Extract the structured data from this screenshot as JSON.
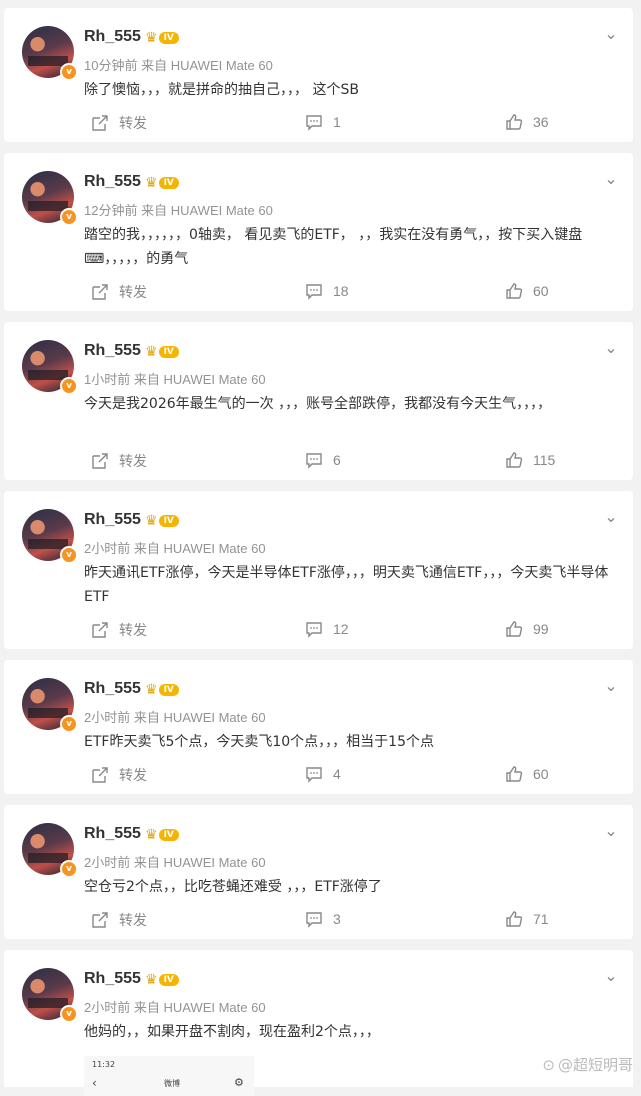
{
  "feed": {
    "comments": [
      {
        "user": "Rh_555",
        "level": "IV",
        "verified": "v",
        "time": "10分钟前",
        "source": "来自 HUAWEI Mate 60",
        "text": "除了懊恼，，，就是拼命的抽自己，，，  这个SB",
        "share": "转发",
        "comments": "1",
        "likes": "36"
      },
      {
        "user": "Rh_555",
        "level": "IV",
        "verified": "v",
        "time": "12分钟前",
        "source": "来自 HUAWEI Mate 60",
        "text": "踏空的我，，，，，，0轴卖，  看见卖飞的ETF，     ，，我实在没有勇气，，按下买入键盘⌨，，，，，的勇气",
        "share": "转发",
        "comments": "18",
        "likes": "60"
      },
      {
        "user": "Rh_555",
        "level": "IV",
        "verified": "v",
        "time": "1小时前",
        "source": "来自 HUAWEI Mate 60",
        "text": "今天是我2026年最生气的一次  ，，，账号全部跌停，我都没有今天生气，，，，",
        "share": "转发",
        "comments": "6",
        "likes": "115"
      },
      {
        "user": "Rh_555",
        "level": "IV",
        "verified": "v",
        "time": "2小时前",
        "source": "来自 HUAWEI Mate 60",
        "text": "昨天通讯ETF涨停，今天是半导体ETF涨停，，，明天卖飞通信ETF，，，今天卖飞半导体ETF",
        "share": "转发",
        "comments": "12",
        "likes": "99"
      },
      {
        "user": "Rh_555",
        "level": "IV",
        "verified": "v",
        "time": "2小时前",
        "source": "来自 HUAWEI Mate 60",
        "text": "ETF昨天卖飞5个点，今天卖飞10个点，，，相当于15个点",
        "share": "转发",
        "comments": "4",
        "likes": "60"
      },
      {
        "user": "Rh_555",
        "level": "IV",
        "verified": "v",
        "time": "2小时前",
        "source": "来自 HUAWEI Mate 60",
        "text": "空仓亏2个点，，比吃苍蝇还难受  ，，，ETF涨停了",
        "share": "转发",
        "comments": "3",
        "likes": "71"
      },
      {
        "user": "Rh_555",
        "level": "IV",
        "verified": "v",
        "time": "2小时前",
        "source": "来自 HUAWEI Mate 60",
        "text": "他妈的，，如果开盘不割肉，现在盈利2个点，，，",
        "share": "",
        "comments": "",
        "likes": ""
      }
    ],
    "embedded_shot": {
      "time": "11:32",
      "back": "‹",
      "title": "微博",
      "gear": "⚙"
    }
  },
  "watermark": {
    "text": "@超短明哥"
  },
  "icons": {
    "share": "share-icon",
    "comment": "comment-icon",
    "like": "thumbs-up-icon",
    "menu": "chevron-down-icon",
    "level": "crown-icon",
    "verified": "verified-v-icon"
  },
  "colors": {
    "background": "#f2f2f2",
    "card": "#ffffff",
    "text": "#333333",
    "meta": "#939393",
    "vip_orange": "#f7931e",
    "level_gold": "#f5b400"
  }
}
